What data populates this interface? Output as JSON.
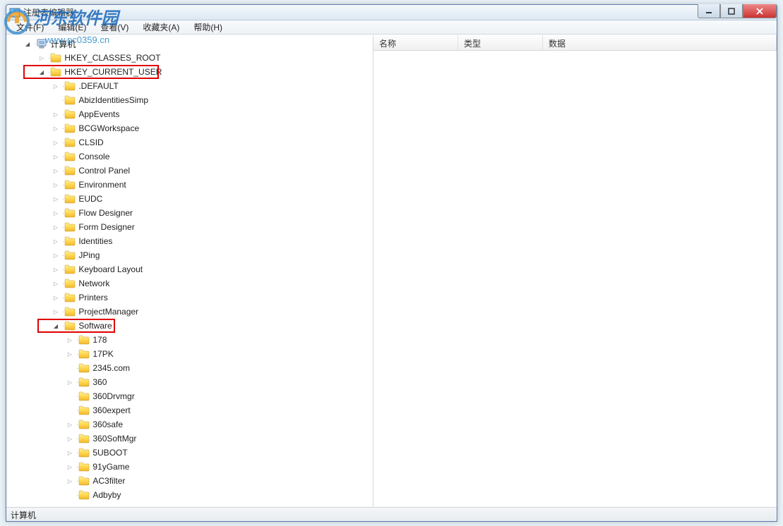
{
  "window": {
    "title": "注册表编辑器"
  },
  "menu": {
    "file": "文件(F)",
    "edit": "编辑(E)",
    "view": "查看(V)",
    "favorites": "收藏夹(A)",
    "help": "帮助(H)"
  },
  "win_controls": {
    "min": "─",
    "max": "☐",
    "close": "✕"
  },
  "tree": {
    "root": "计算机",
    "nodes": [
      {
        "level": 1,
        "exp": "expanded",
        "label": "计算机",
        "icon": "computer"
      },
      {
        "level": 2,
        "exp": "collapsed",
        "label": "HKEY_CLASSES_ROOT"
      },
      {
        "level": 2,
        "exp": "expanded",
        "label": "HKEY_CURRENT_USER",
        "hl": true
      },
      {
        "level": 3,
        "exp": "collapsed",
        "label": ".DEFAULT"
      },
      {
        "level": 3,
        "exp": "none",
        "label": "AbizIdentitiesSimp"
      },
      {
        "level": 3,
        "exp": "collapsed",
        "label": "AppEvents"
      },
      {
        "level": 3,
        "exp": "collapsed",
        "label": "BCGWorkspace"
      },
      {
        "level": 3,
        "exp": "collapsed",
        "label": "CLSID"
      },
      {
        "level": 3,
        "exp": "collapsed",
        "label": "Console"
      },
      {
        "level": 3,
        "exp": "collapsed",
        "label": "Control Panel"
      },
      {
        "level": 3,
        "exp": "collapsed",
        "label": "Environment"
      },
      {
        "level": 3,
        "exp": "collapsed",
        "label": "EUDC"
      },
      {
        "level": 3,
        "exp": "collapsed",
        "label": "Flow Designer"
      },
      {
        "level": 3,
        "exp": "collapsed",
        "label": "Form Designer"
      },
      {
        "level": 3,
        "exp": "collapsed",
        "label": "Identities"
      },
      {
        "level": 3,
        "exp": "collapsed",
        "label": "JPing"
      },
      {
        "level": 3,
        "exp": "collapsed",
        "label": "Keyboard Layout"
      },
      {
        "level": 3,
        "exp": "collapsed",
        "label": "Network"
      },
      {
        "level": 3,
        "exp": "collapsed",
        "label": "Printers"
      },
      {
        "level": 3,
        "exp": "collapsed",
        "label": "ProjectManager"
      },
      {
        "level": 3,
        "exp": "expanded",
        "label": "Software",
        "hl": true
      },
      {
        "level": 4,
        "exp": "collapsed",
        "label": "178"
      },
      {
        "level": 4,
        "exp": "collapsed",
        "label": "17PK"
      },
      {
        "level": 4,
        "exp": "none",
        "label": "2345.com"
      },
      {
        "level": 4,
        "exp": "collapsed",
        "label": "360"
      },
      {
        "level": 4,
        "exp": "none",
        "label": "360Drvmgr"
      },
      {
        "level": 4,
        "exp": "none",
        "label": "360expert"
      },
      {
        "level": 4,
        "exp": "collapsed",
        "label": "360safe"
      },
      {
        "level": 4,
        "exp": "collapsed",
        "label": "360SoftMgr"
      },
      {
        "level": 4,
        "exp": "collapsed",
        "label": "5UBOOT"
      },
      {
        "level": 4,
        "exp": "collapsed",
        "label": "91yGame"
      },
      {
        "level": 4,
        "exp": "collapsed",
        "label": "AC3filter"
      },
      {
        "level": 4,
        "exp": "none",
        "label": "Adbyby"
      }
    ]
  },
  "list_columns": {
    "name": "名称",
    "type": "类型",
    "data": "数据"
  },
  "statusbar": {
    "path": "计算机"
  },
  "watermark": {
    "text": "河东软件园",
    "url": "www.pc0359.cn"
  }
}
